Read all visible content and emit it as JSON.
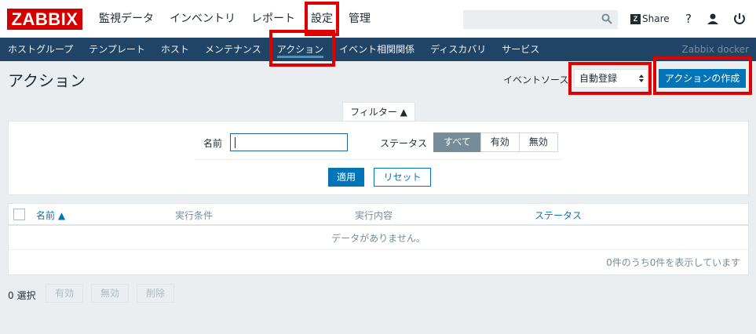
{
  "header": {
    "logo": "ZABBIX",
    "menu": [
      "監視データ",
      "インベントリ",
      "レポート",
      "設定",
      "管理"
    ],
    "active_menu": "設定",
    "search_placeholder": "",
    "share_label": "Share",
    "share_logo": "Z",
    "help_label": "?"
  },
  "subnav": {
    "items": [
      "ホストグループ",
      "テンプレート",
      "ホスト",
      "メンテナンス",
      "アクション",
      "イベント相関関係",
      "ディスカバリ",
      "サービス"
    ],
    "active": "アクション",
    "host_name": "Zabbix docker"
  },
  "page": {
    "title": "アクション",
    "event_source_label": "イベントソース",
    "event_source_value": "自動登録",
    "create_button": "アクションの作成"
  },
  "filter": {
    "tab_label": "フィルター ▲",
    "name_label": "名前",
    "name_value": "",
    "status_label": "ステータス",
    "status_options": [
      "すべて",
      "有効",
      "無効"
    ],
    "status_selected": "すべて",
    "apply_button": "適用",
    "reset_button": "リセット"
  },
  "table": {
    "columns": [
      "名前 ▲",
      "実行条件",
      "実行内容",
      "ステータス"
    ],
    "empty_message": "データがありません。",
    "paging_text": "0件のうち0件を表示しています"
  },
  "footer": {
    "selected_text": "0 選択",
    "buttons": [
      "有効",
      "無効",
      "削除"
    ]
  },
  "colors": {
    "brand": "#d40000",
    "nav_bg": "#1f4466",
    "primary": "#0275b8",
    "highlight": "#e00000"
  }
}
